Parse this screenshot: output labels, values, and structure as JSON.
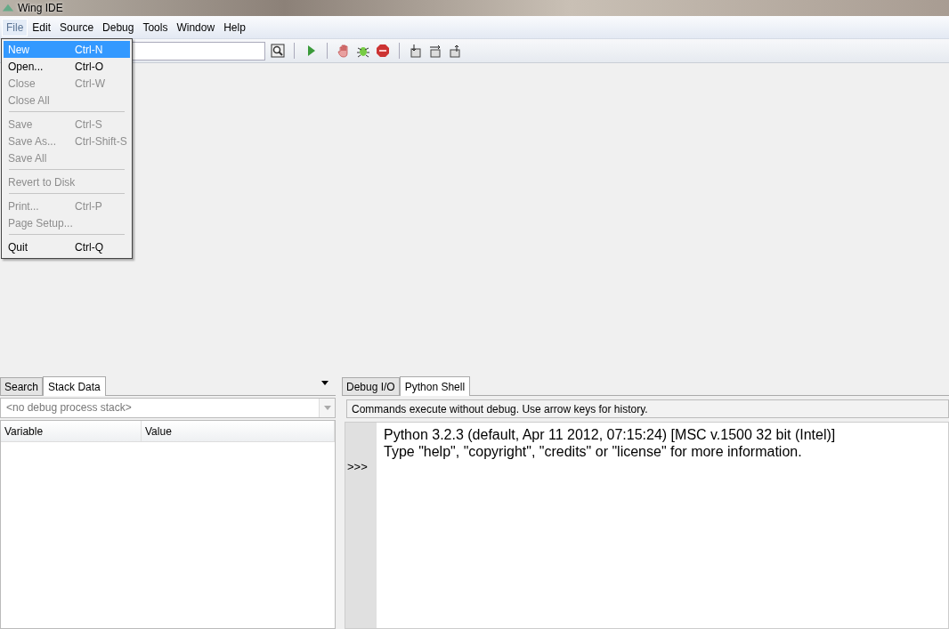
{
  "window": {
    "title": "Wing IDE"
  },
  "menu_bar": [
    {
      "label": "File",
      "selected": true
    },
    {
      "label": "Edit",
      "selected": false
    },
    {
      "label": "Source",
      "selected": false
    },
    {
      "label": "Debug",
      "selected": false
    },
    {
      "label": "Tools",
      "selected": false
    },
    {
      "label": "Window",
      "selected": false
    },
    {
      "label": "Help",
      "selected": false
    }
  ],
  "file_menu": [
    {
      "kind": "item",
      "label": "New",
      "shortcut": "Ctrl-N",
      "selected": true,
      "disabled": false
    },
    {
      "kind": "item",
      "label": "Open...",
      "shortcut": "Ctrl-O",
      "selected": false,
      "disabled": false
    },
    {
      "kind": "item",
      "label": "Close",
      "shortcut": "Ctrl-W",
      "selected": false,
      "disabled": true
    },
    {
      "kind": "item",
      "label": "Close All",
      "selected": false,
      "disabled": true
    },
    {
      "kind": "separator"
    },
    {
      "kind": "item",
      "label": "Save",
      "shortcut": "Ctrl-S",
      "selected": false,
      "disabled": true
    },
    {
      "kind": "item",
      "label": "Save As...",
      "shortcut": "Ctrl-Shift-S",
      "selected": false,
      "disabled": true
    },
    {
      "kind": "item",
      "label": "Save All",
      "selected": false,
      "disabled": true
    },
    {
      "kind": "separator"
    },
    {
      "kind": "item",
      "label": "Revert to Disk",
      "selected": false,
      "disabled": true
    },
    {
      "kind": "separator"
    },
    {
      "kind": "item",
      "label": "Print...",
      "shortcut": "Ctrl-P",
      "selected": false,
      "disabled": true
    },
    {
      "kind": "item",
      "label": "Page Setup...",
      "selected": false,
      "disabled": true
    },
    {
      "kind": "separator"
    },
    {
      "kind": "item",
      "label": "Quit",
      "shortcut": "Ctrl-Q",
      "selected": false,
      "disabled": false
    }
  ],
  "left_panel": {
    "tabs": [
      {
        "label": "Search",
        "selected": false
      },
      {
        "label": "Stack Data",
        "selected": true
      }
    ],
    "stack_select": {
      "value": "<no debug process stack>"
    },
    "columns": [
      "Variable",
      "Value"
    ]
  },
  "right_panel": {
    "tabs": [
      {
        "label": "Debug I/O",
        "selected": false
      },
      {
        "label": "Python Shell",
        "selected": true
      }
    ],
    "hint": "Commands execute without debug.  Use arrow keys for history.",
    "prompt": ">>>",
    "output": [
      "Python 3.2.3 (default, Apr 11 2012, 07:15:24) [MSC v.1500 32 bit (Intel)]",
      "Type \"help\", \"copyright\", \"credits\" or \"license\" for more information."
    ]
  }
}
